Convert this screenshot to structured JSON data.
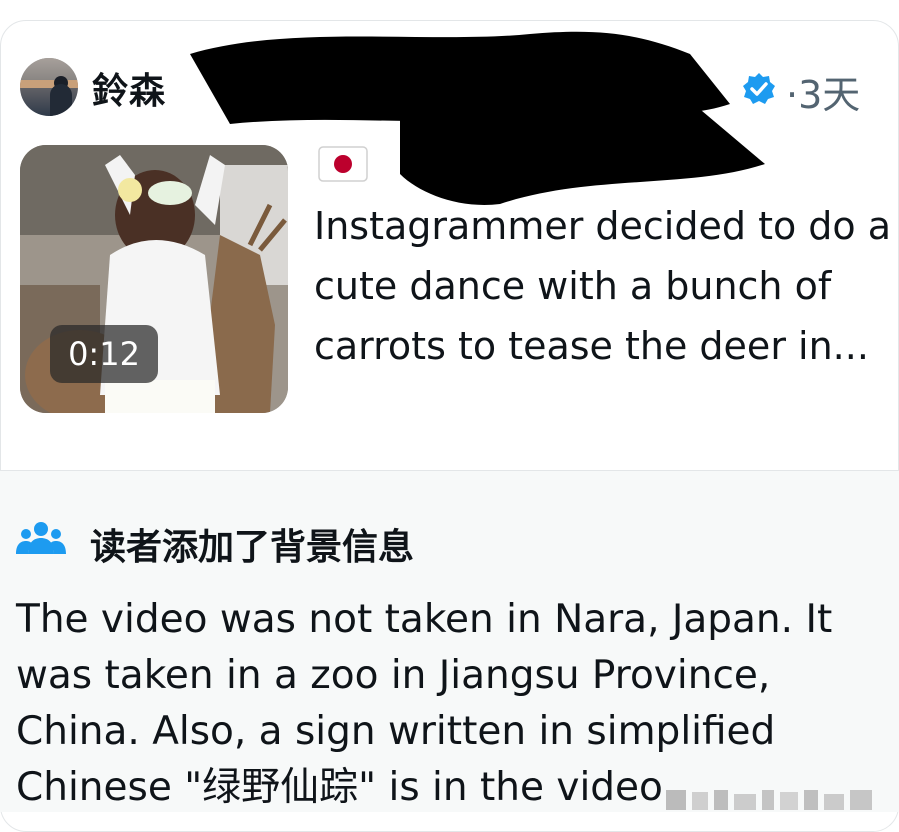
{
  "post": {
    "author": {
      "display_name": "鈴森"
    },
    "verified_icon": "verified-badge-icon",
    "time_label": "·3天",
    "flag_icon": "japan-flag-icon",
    "video": {
      "duration": "0:12"
    },
    "text": "Instagrammer decided to do a cute dance with a bunch of carrots to tease the deer in..."
  },
  "community_note": {
    "icon": "people-group-icon",
    "title": "读者添加了背景信息",
    "body": "The video was not taken in Nara, Japan. It was taken in a zoo in Jiangsu Province, China. Also, a sign written in simplified Chinese \"绿野仙踪\" is in the video"
  },
  "colors": {
    "verified_blue": "#1d9bf0",
    "notes_icon_blue": "#1d9bf0",
    "secondary_text": "#536471",
    "note_background": "#f7f9f9"
  }
}
